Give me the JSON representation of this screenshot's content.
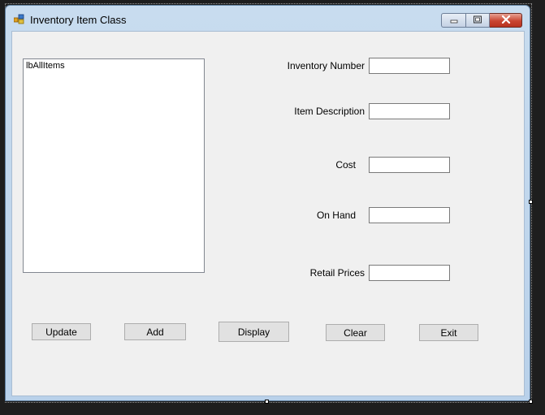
{
  "window": {
    "title": "Inventory Item Class"
  },
  "listbox": {
    "name_text": "lbAllItems"
  },
  "fields": [
    {
      "label": "Inventory Number",
      "value": ""
    },
    {
      "label": "Item Description",
      "value": ""
    },
    {
      "label": "Cost",
      "value": ""
    },
    {
      "label": "On Hand",
      "value": ""
    },
    {
      "label": "Retail Prices",
      "value": ""
    }
  ],
  "buttons": {
    "update": "Update",
    "add": "Add",
    "display": "Display",
    "clear": "Clear",
    "exit": "Exit"
  },
  "icons": {
    "app": "form-icon",
    "minimize": "minimize-icon",
    "maximize": "maximize-icon",
    "close": "close-icon"
  },
  "colors": {
    "title_bar": "#b9d1ea",
    "client_background": "#f0f0f0",
    "close_button": "#c94531"
  }
}
